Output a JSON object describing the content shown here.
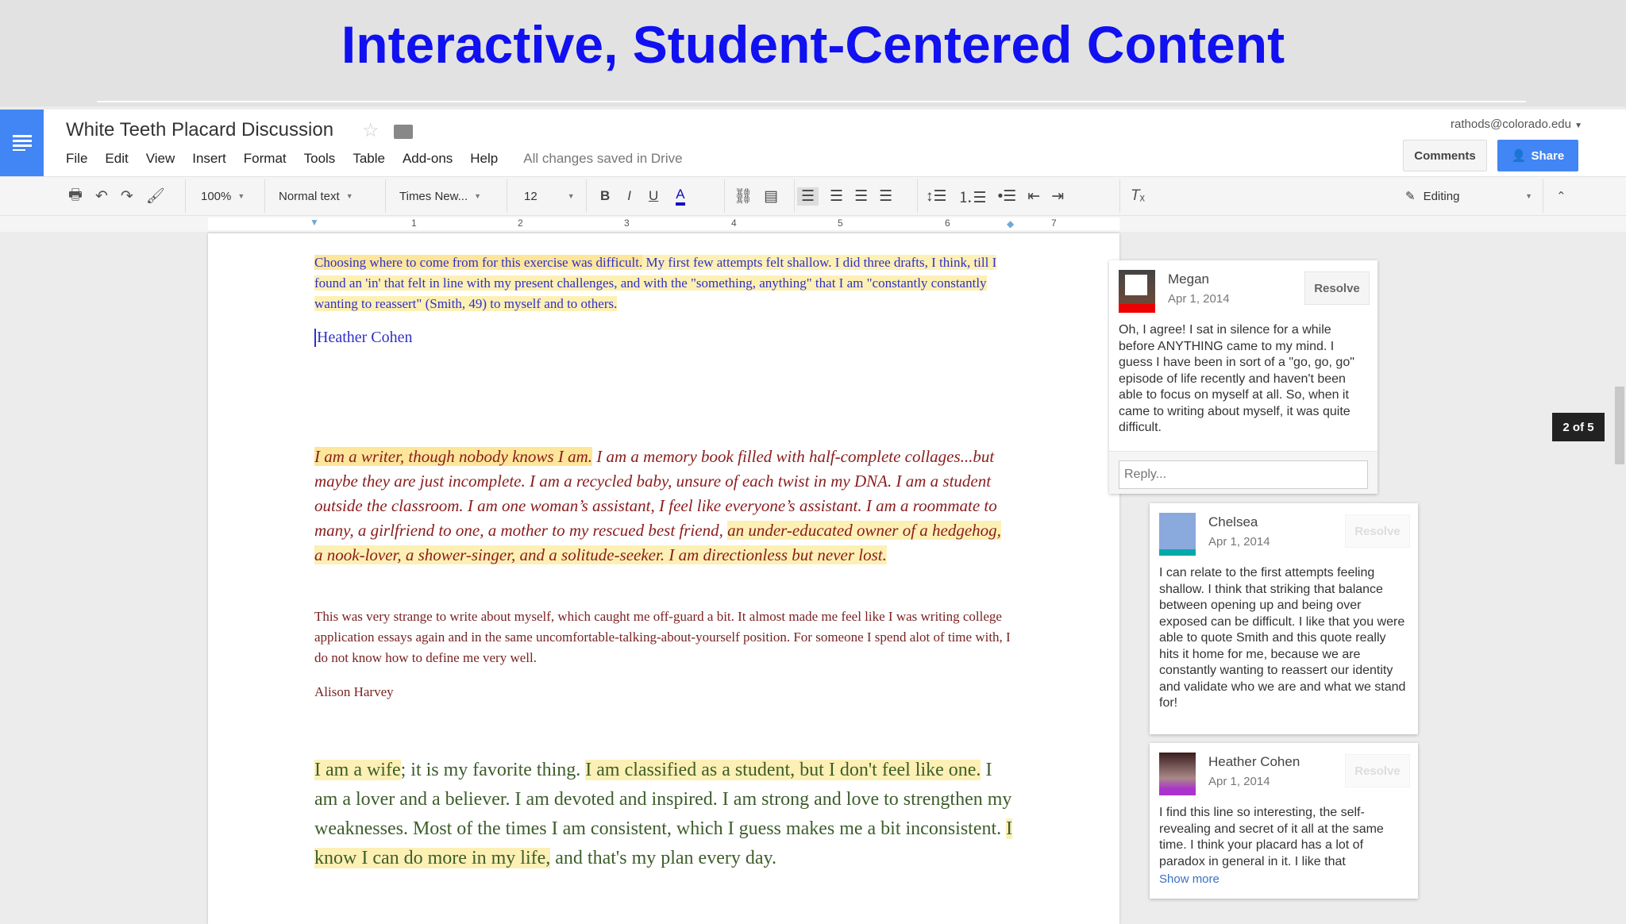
{
  "slide_title": "Interactive, Student-Centered Content",
  "doc": {
    "title": "White Teeth Placard Discussion",
    "status": "All changes saved in Drive",
    "account": "rathods@colorado.edu"
  },
  "menu": [
    "File",
    "Edit",
    "View",
    "Insert",
    "Format",
    "Tools",
    "Table",
    "Add-ons",
    "Help"
  ],
  "buttons": {
    "comments": "Comments",
    "share": "Share"
  },
  "toolbar": {
    "zoom": "100%",
    "style": "Normal text",
    "font": "Times New...",
    "size": "12",
    "bold": "B",
    "italic": "I",
    "underline": "U",
    "text_color": "A",
    "mode": "Editing",
    "text_color_hex": "#1010c0"
  },
  "ruler": [
    "1",
    "2",
    "3",
    "4",
    "5",
    "6",
    "7"
  ],
  "body": {
    "p1a": "Choosing where to come from for this exercise was difficult.",
    "p1b": " My first few attempts felt shallow.  I did three drafts, I think, till I found an 'in' that felt in line with my present challenges, and with the \"something, anything\" that I am \"constantly constantly wanting to reassert\" (Smith, 49) to myself and to others.",
    "sig1": "Heather Cohen",
    "p2a": "I am a writer, though nobody knows I am.",
    "p2b": "  I am a memory book filled with half-complete collages...but maybe they are just incomplete.  I am a recycled baby, unsure of each twist in my DNA.  I am a student outside the classroom.  I am one woman’s assistant, I feel like everyone’s assistant.  I am a roommate to many, a girlfriend to one, a mother to my rescued best friend, ",
    "p2c": "an under-educated owner of a hedgehog, a nook-lover, a shower-singer, and a solitude-seeker.  I am directionless but never lost.",
    "p3": "This was very strange to write about myself, which caught me off-guard a bit.  It almost made me feel like I was writing college application essays again and in the same uncomfortable-talking-about-yourself position.  For someone I spend alot of time with, I do not know how to define me very well.",
    "sig2": "Alison Harvey",
    "p4a": "I am a wife",
    "p4b": "; it is my favorite thing. ",
    "p4c": "I am classified as a student, but I don't feel like one.",
    "p4d": " I am a lover and a believer. I am devoted and inspired. I am strong and love to strengthen my weaknesses. Most of the times I am consistent, which I guess makes me a bit inconsistent. ",
    "p4e": "I know I can do more in my life,",
    "p4f": " and that's my plan every day."
  },
  "comments": [
    {
      "name": "Megan",
      "date": "Apr 1, 2014",
      "resolve": "Resolve",
      "text": "Oh, I agree! I sat in silence for a while before ANYTHING came to my mind. I guess I have been in sort of a \"go, go, go\" episode of life recently and haven't been able to focus on myself at all. So, when it came to writing about myself, it was quite difficult.",
      "reply_placeholder": "Reply..."
    },
    {
      "name": "Chelsea",
      "date": "Apr 1, 2014",
      "resolve": "Resolve",
      "text": "I can relate to the first attempts feeling shallow. I think that striking that balance between opening up and being over exposed can be difficult. I like that you were able to quote Smith and this quote really hits it home for me, because we are constantly wanting to reassert our identity and validate who we are and what we stand for!"
    },
    {
      "name": "Heather Cohen",
      "date": "Apr 1, 2014",
      "resolve": "Resolve",
      "text": "I find this line so interesting, the self-revealing and secret of it all at the same time. I think your placard has a lot of paradox in general in it. I like that",
      "more": "Show more"
    }
  ],
  "comment_counter": "2 of 5"
}
